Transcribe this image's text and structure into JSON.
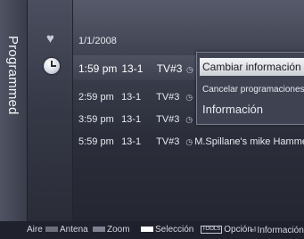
{
  "side_title": "Programmed",
  "icons": {
    "favorite": "heart-icon",
    "timer": "clock-icon"
  },
  "date": "1/1/2008",
  "schedule": [
    {
      "time": "1:59 pm",
      "channel": "13-1",
      "station": "TV#3",
      "icon": "clock-small-icon",
      "title": ""
    },
    {
      "time": "2:59 pm",
      "channel": "13-1",
      "station": "TV#3",
      "icon": "clock-small-icon",
      "title": ""
    },
    {
      "time": "3:59 pm",
      "channel": "13-1",
      "station": "TV#3",
      "icon": "clock-small-icon",
      "title": ""
    },
    {
      "time": "5:59 pm",
      "channel": "13-1",
      "station": "TV#3",
      "icon": "clock-small-icon",
      "title": "M.Spillane's mike Hammer"
    }
  ],
  "popup_menu": {
    "items": [
      "Cambiar información",
      "Cancelar programaciones",
      "Información"
    ],
    "selected_index": 0
  },
  "footer": {
    "aire": "Aire",
    "antena": "Antena",
    "zoom": "Zoom",
    "seleccion": "Selección",
    "tools_badge": "TOOLS",
    "opcion": "Opción",
    "informacion": "Información",
    "colors": {
      "antena": "#6b6f7c",
      "zoom": "#7e8290",
      "seleccion": "#ffffff"
    }
  }
}
